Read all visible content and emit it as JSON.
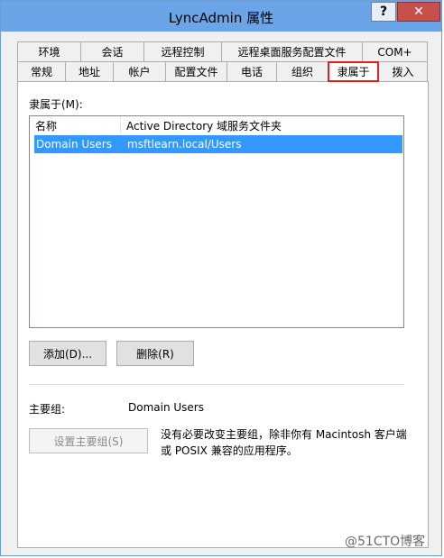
{
  "window": {
    "title": "LyncAdmin 属性",
    "help_label": "?",
    "close_label": "✕"
  },
  "tabs_row1": [
    "环境",
    "会话",
    "远程控制",
    "远程桌面服务配置文件",
    "COM+"
  ],
  "tabs_row2": [
    "常规",
    "地址",
    "帐户",
    "配置文件",
    "电话",
    "组织",
    "隶属于",
    "拨入"
  ],
  "active_tab": "隶属于",
  "member_of": {
    "label": "隶属于(M):",
    "columns": [
      "名称",
      "Active Directory 域服务文件夹"
    ],
    "rows": [
      {
        "name": "Domain Users",
        "folder": "msftlearn.local/Users"
      }
    ]
  },
  "buttons": {
    "add": "添加(D)...",
    "remove": "删除(R)",
    "set_primary": "设置主要组(S)"
  },
  "primary_group": {
    "label": "主要组:",
    "value": "Domain Users",
    "note": "没有必要改变主要组，除非你有 Macintosh 客户端或 POSIX 兼容的应用程序。"
  },
  "watermark": "@51CTO博客",
  "colors": {
    "titlebar": "#6ba5e7",
    "selection": "#3399ff",
    "active_tab_border": "#e0201c",
    "close_button": "#c7504a"
  }
}
